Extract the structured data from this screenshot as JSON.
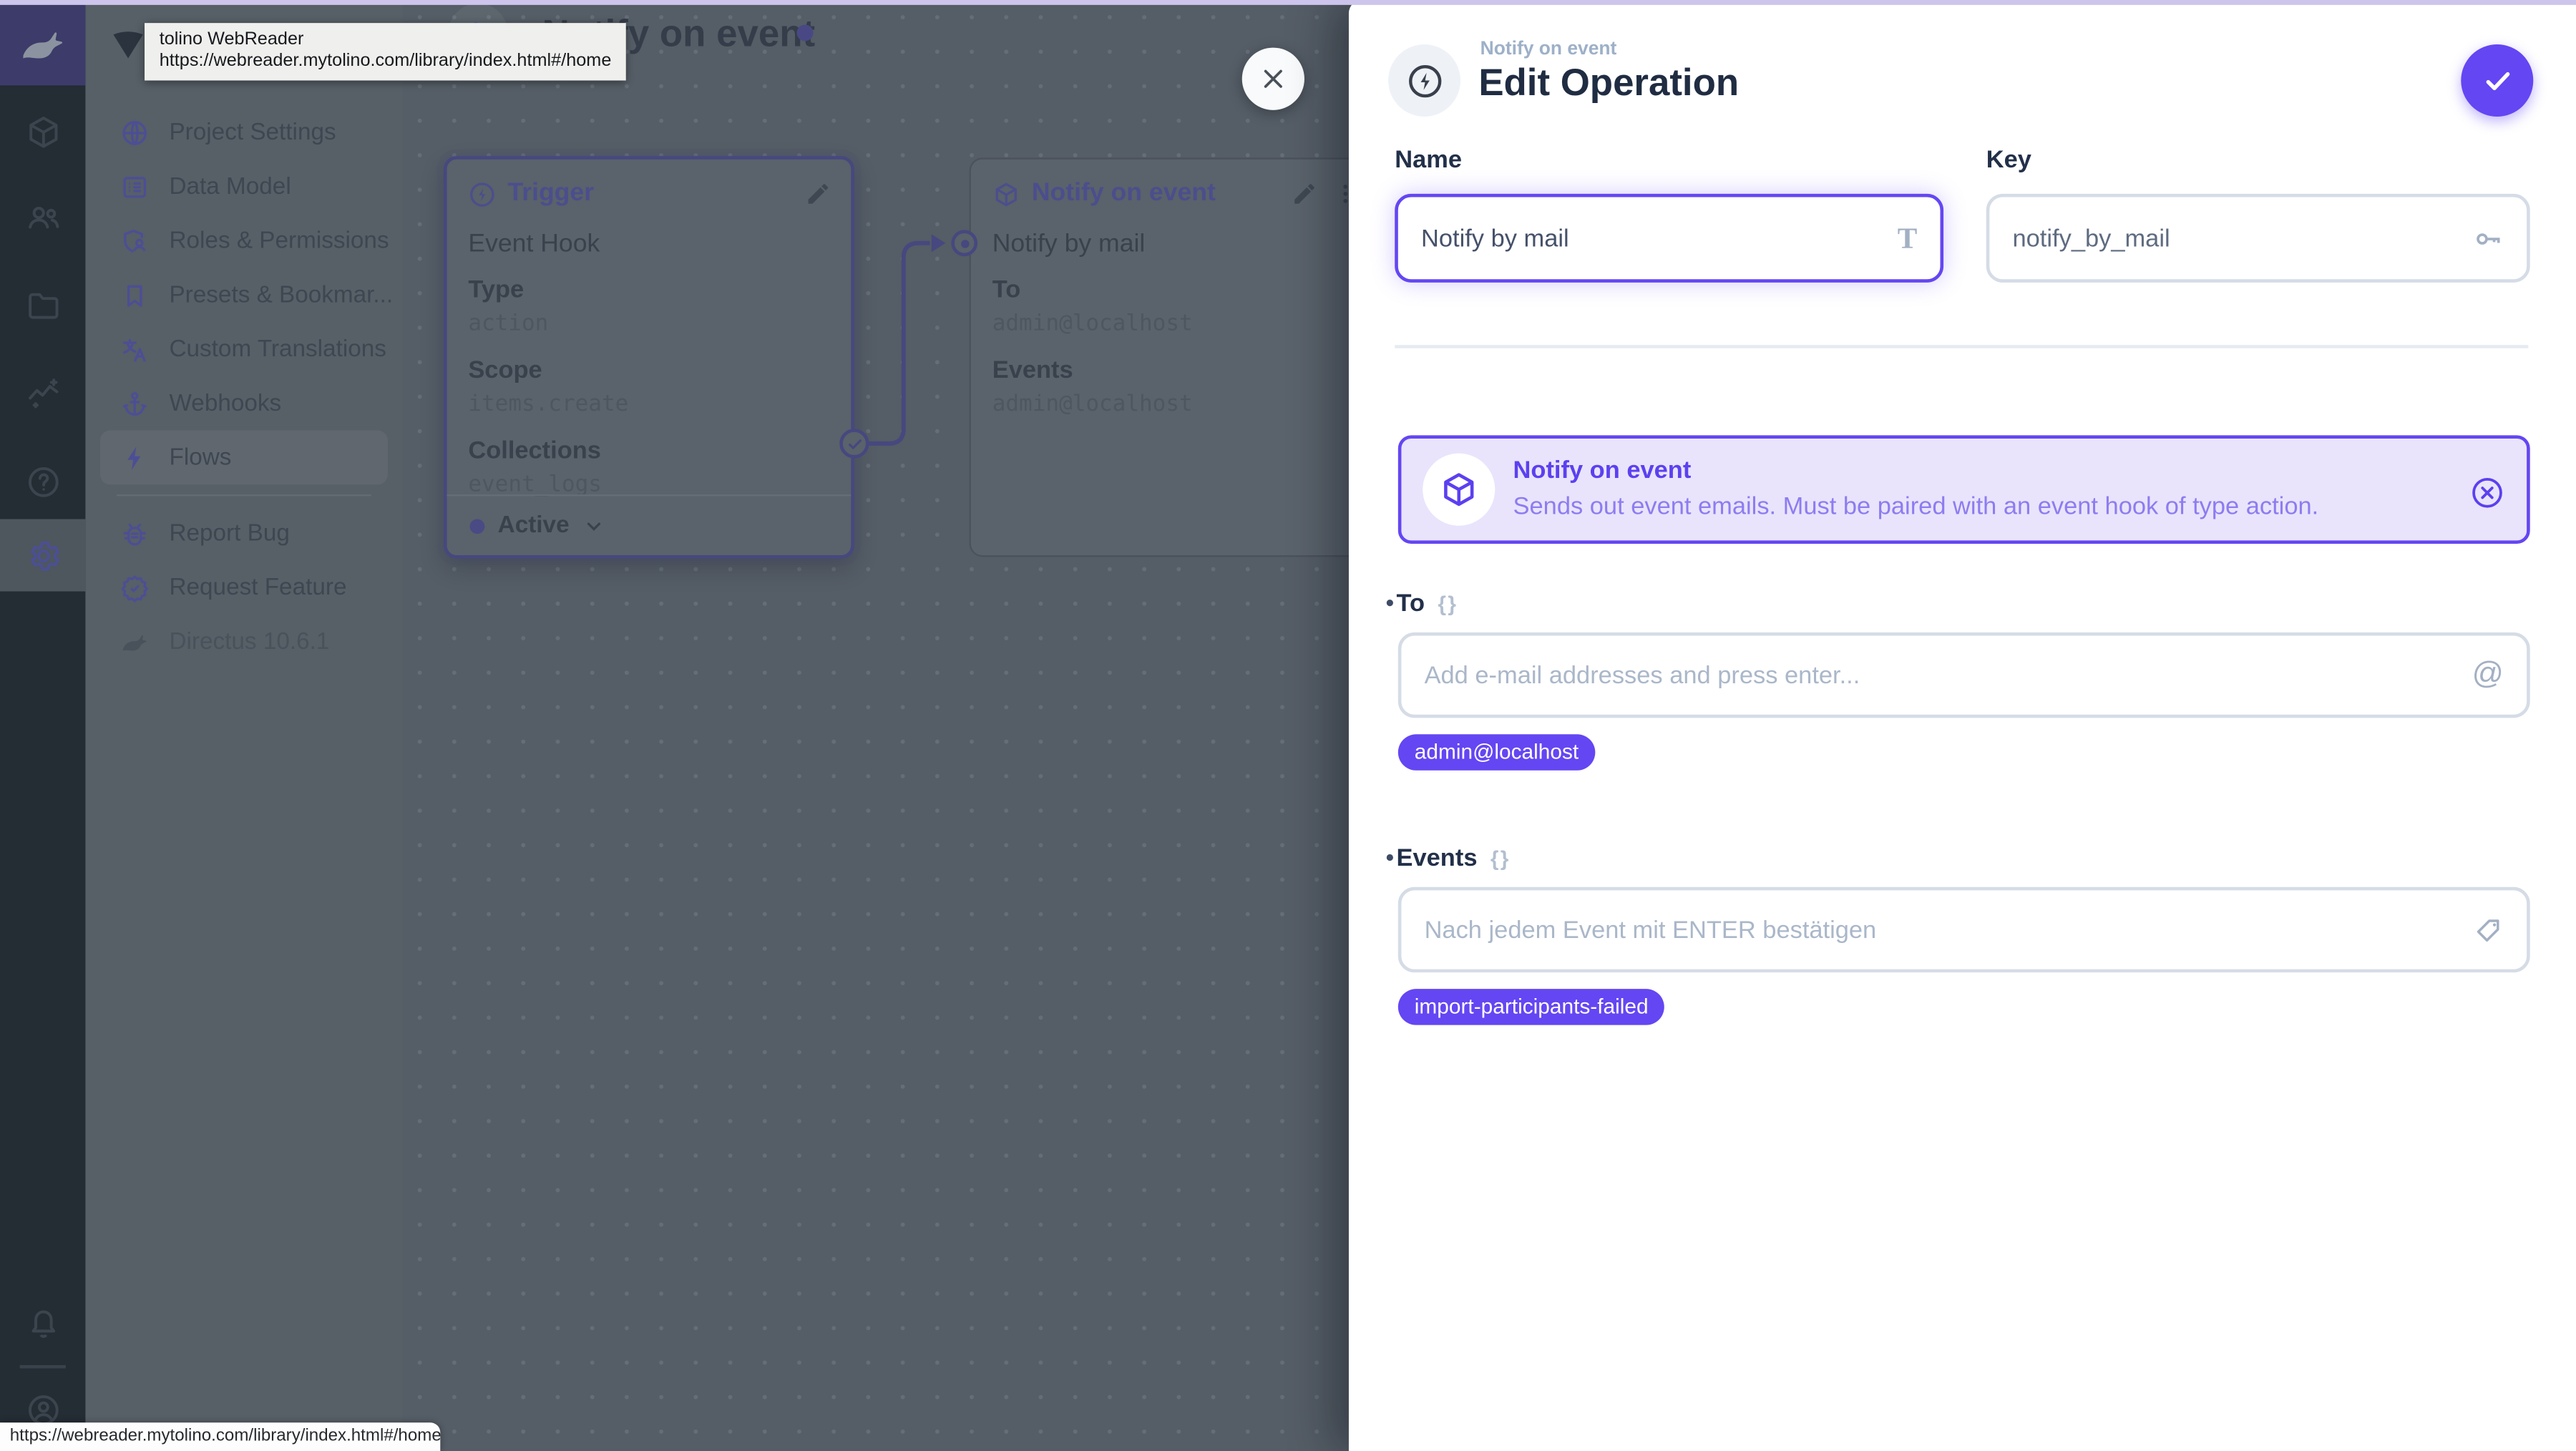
{
  "app": {
    "version_label": "Directus 10.6.1"
  },
  "colors": {
    "accent": "#6446f3",
    "accent_dim": "#46487f",
    "canvas_bg": "#555d66",
    "module_bar_bg": "#242c34",
    "sidebar_bg": "#575f67",
    "banner_bg": "#e9e4fc",
    "top_strip": "#cec5ec"
  },
  "tooltip": {
    "title": "tolino WebReader",
    "url": "https://webreader.mytolino.com/library/index.html#/home"
  },
  "status_bar": {
    "url": "https://webreader.mytolino.com/library/index.html#/home"
  },
  "module_bar": {
    "icons": [
      "directus-logo",
      "box",
      "people",
      "folder",
      "insights",
      "help",
      "settings",
      "notifications",
      "user"
    ]
  },
  "sidebar": {
    "items": [
      {
        "label": "Project Settings",
        "icon": "globe"
      },
      {
        "label": "Data Model",
        "icon": "list"
      },
      {
        "label": "Roles & Permissions",
        "icon": "shield-person"
      },
      {
        "label": "Presets & Bookmar...",
        "icon": "bookmark"
      },
      {
        "label": "Custom Translations",
        "icon": "translate"
      },
      {
        "label": "Webhooks",
        "icon": "anchor"
      },
      {
        "label": "Flows",
        "icon": "bolt",
        "active": true
      },
      {
        "label": "Report Bug",
        "icon": "bug"
      },
      {
        "label": "Request Feature",
        "icon": "verified"
      },
      {
        "label": "Directus 10.6.1",
        "icon": "directus-logo",
        "muted": true
      }
    ]
  },
  "page": {
    "title": "Notify on event"
  },
  "trigger_card": {
    "title": "Trigger",
    "name": "Event Hook",
    "fields": [
      {
        "label": "Type",
        "value": "action"
      },
      {
        "label": "Scope",
        "value": "items.create"
      },
      {
        "label": "Collections",
        "value": "event_logs"
      }
    ],
    "status": "Active"
  },
  "operation_card": {
    "title": "Notify on event",
    "name": "Notify by mail",
    "fields": [
      {
        "label": "To",
        "value": "admin@localhost"
      },
      {
        "label": "Events",
        "value": "admin@localhost"
      }
    ]
  },
  "drawer": {
    "context": "Notify on event",
    "title": "Edit Operation",
    "name": {
      "label": "Name",
      "value": "Notify by mail"
    },
    "key": {
      "label": "Key",
      "value": "notify_by_mail"
    },
    "panel": {
      "title": "Notify on event",
      "description": "Sends out event emails. Must be paired with an event hook of type action."
    },
    "to": {
      "label": "To",
      "placeholder": "Add e-mail addresses and press enter...",
      "chips": [
        "admin@localhost"
      ]
    },
    "events": {
      "label": "Events",
      "placeholder": "Nach jedem Event mit ENTER bestätigen",
      "chips": [
        "import-participants-failed"
      ]
    }
  }
}
